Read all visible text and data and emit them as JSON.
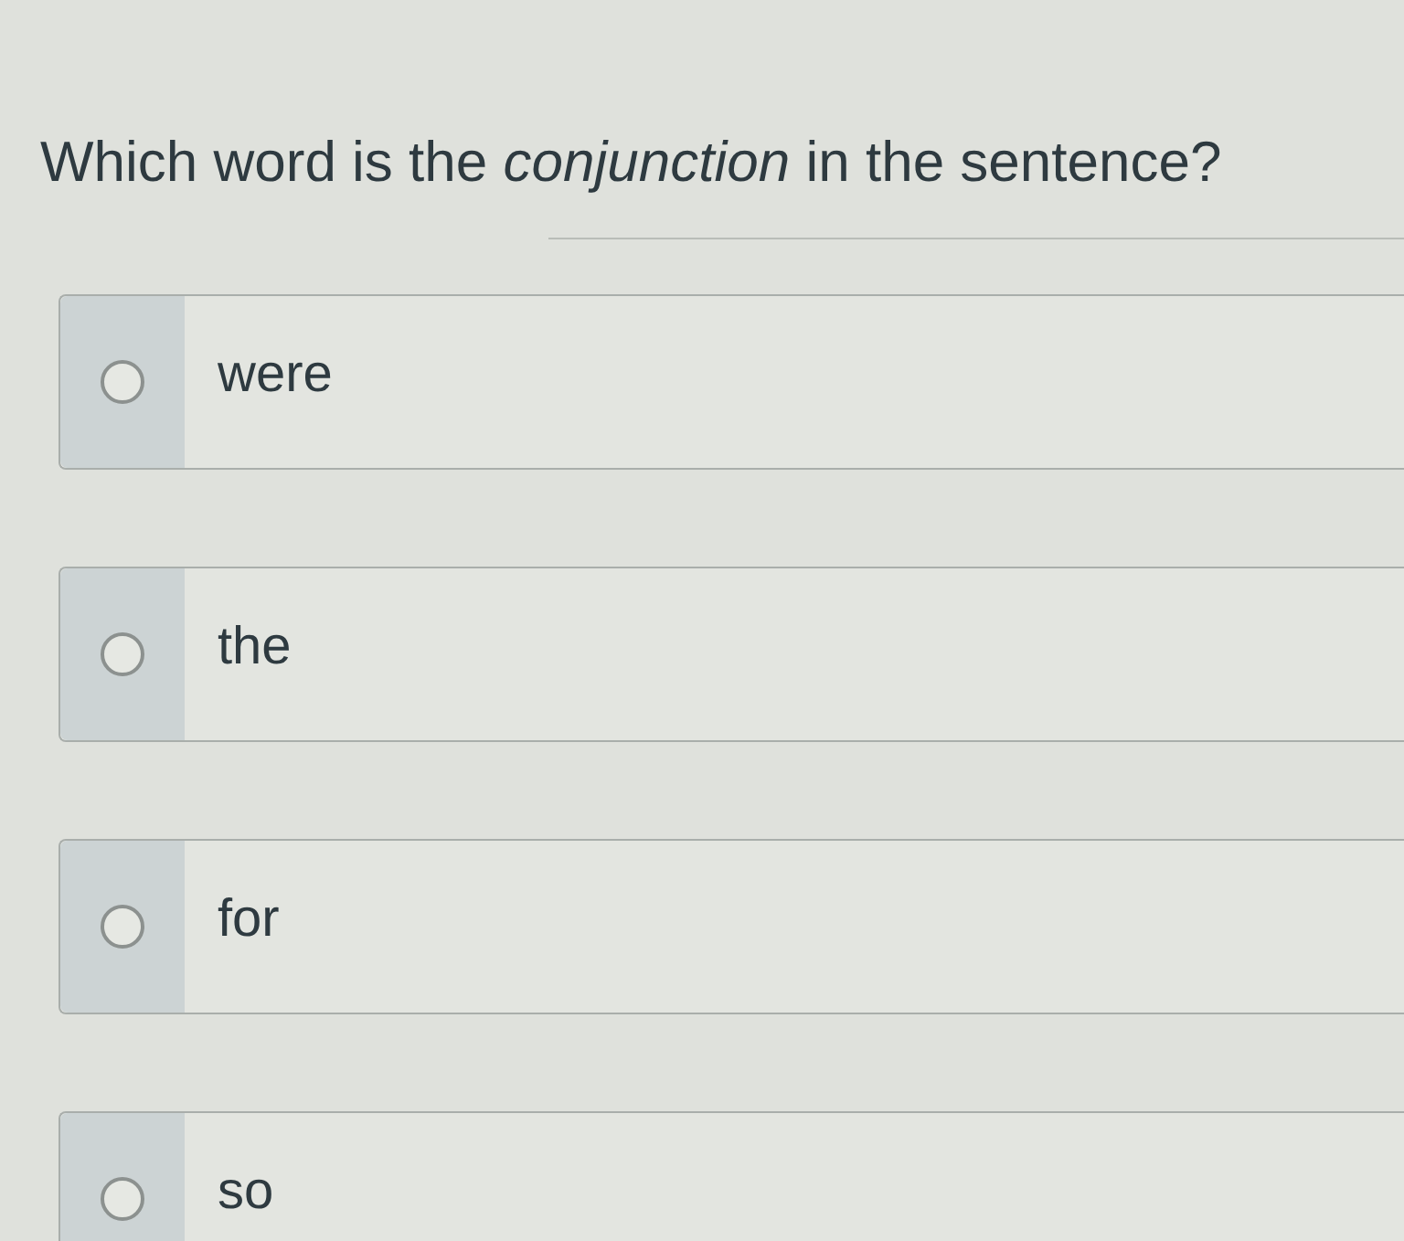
{
  "question": "Which word is the *conjunction* in the sentence?",
  "options": [
    {
      "label": "were",
      "selected": false
    },
    {
      "label": "the",
      "selected": false
    },
    {
      "label": "for",
      "selected": false
    },
    {
      "label": "so",
      "selected": false
    }
  ]
}
